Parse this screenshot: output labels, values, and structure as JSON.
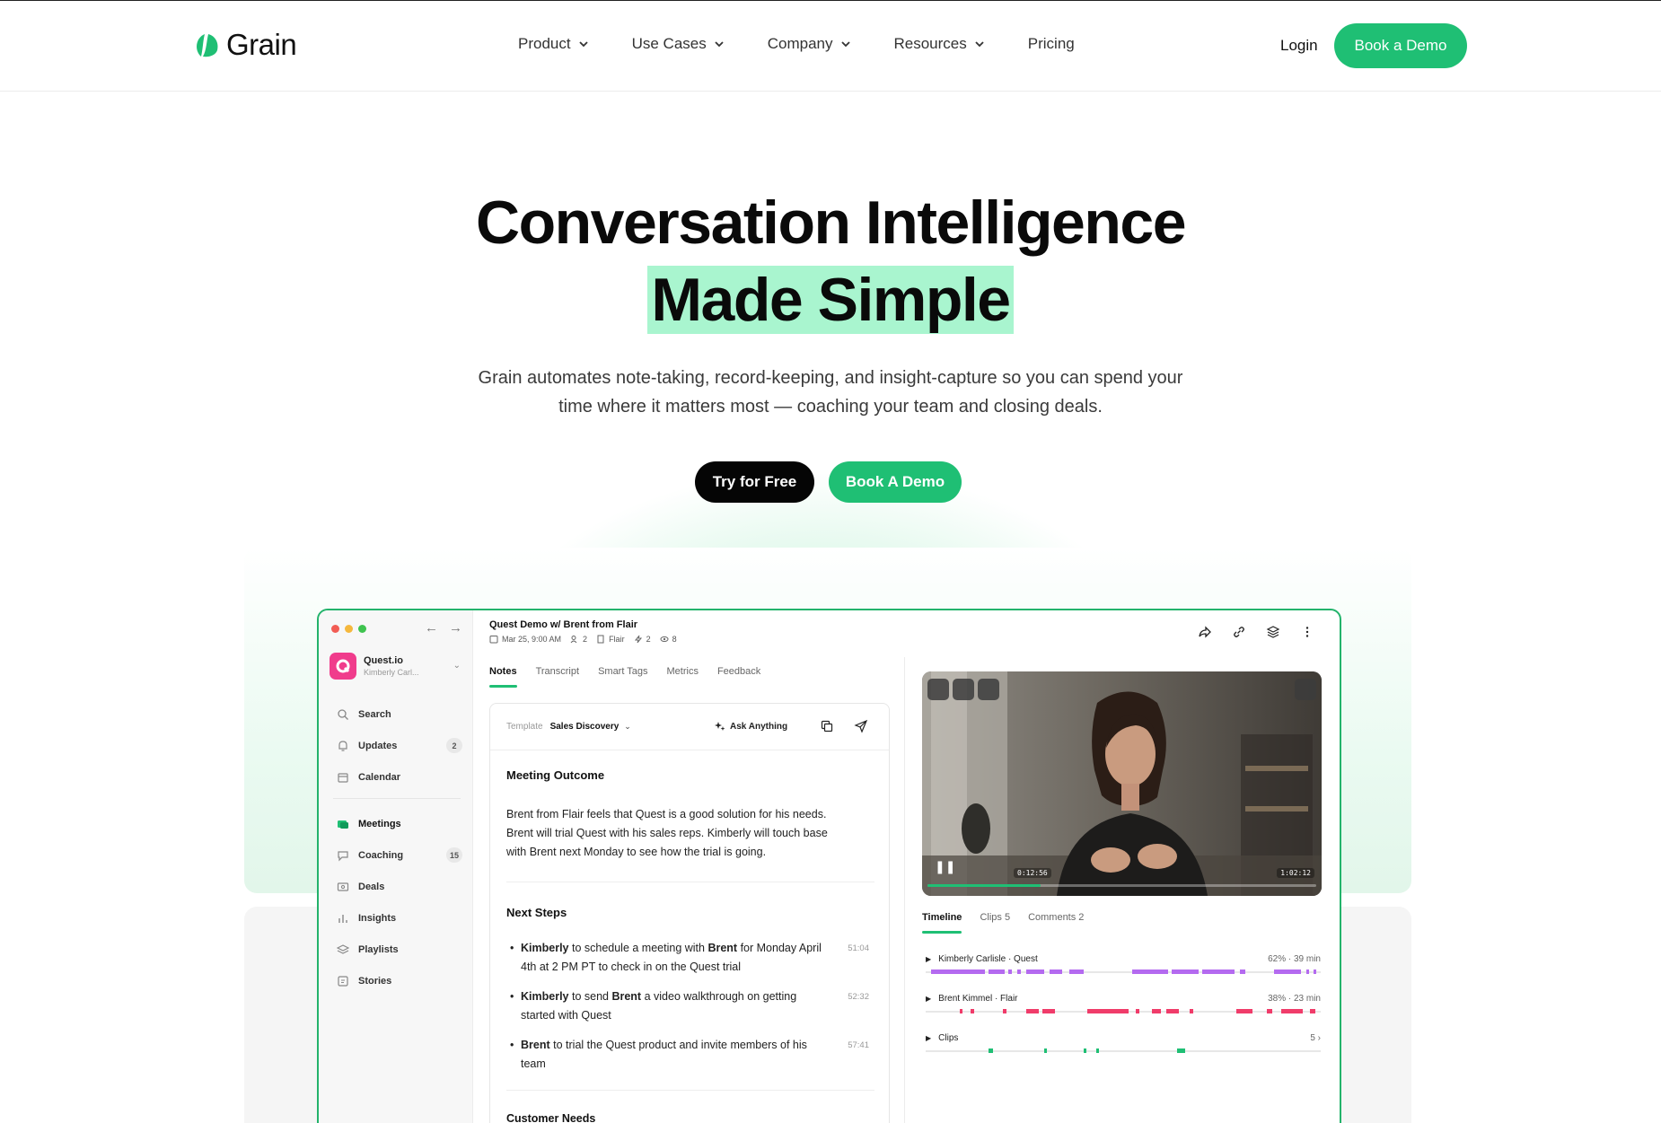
{
  "nav": {
    "brand": "Grain",
    "menu": [
      {
        "label": "Product",
        "dropdown": true
      },
      {
        "label": "Use Cases",
        "dropdown": true
      },
      {
        "label": "Company",
        "dropdown": true
      },
      {
        "label": "Resources",
        "dropdown": true
      },
      {
        "label": "Pricing",
        "dropdown": false
      }
    ],
    "login": "Login",
    "book_demo": "Book a Demo"
  },
  "hero": {
    "title_line1": "Conversation Intelligence",
    "title_line2": "Made Simple",
    "subtitle_line1": "Grain automates note-taking, record-keeping, and insight-capture so you can spend your",
    "subtitle_line2": "time where it matters most — coaching your team and closing deals.",
    "cta_primary": "Try for Free",
    "cta_secondary": "Book A Demo"
  },
  "colors": {
    "brand_green": "#1fbf74",
    "highlight": "#a9f5cf",
    "pink": "#f03c8c",
    "purple": "#b46af0"
  },
  "app": {
    "workspace": {
      "name": "Quest.io",
      "user": "Kimberly Carl..."
    },
    "sidebar": [
      {
        "label": "Search",
        "icon": "search-icon",
        "badge": ""
      },
      {
        "label": "Updates",
        "icon": "bell-icon",
        "badge": "2"
      },
      {
        "label": "Calendar",
        "icon": "calendar-icon",
        "badge": ""
      },
      {
        "label": "Meetings",
        "icon": "meetings-icon",
        "badge": ""
      },
      {
        "label": "Coaching",
        "icon": "coaching-icon",
        "badge": "15"
      },
      {
        "label": "Deals",
        "icon": "deals-icon",
        "badge": ""
      },
      {
        "label": "Insights",
        "icon": "insights-icon",
        "badge": ""
      },
      {
        "label": "Playlists",
        "icon": "playlists-icon",
        "badge": ""
      },
      {
        "label": "Stories",
        "icon": "stories-icon",
        "badge": ""
      }
    ],
    "meeting": {
      "title": "Quest Demo w/ Brent from Flair",
      "date": "Mar 25, 9:00 AM",
      "participants": "2",
      "company": "Flair",
      "clips": "2",
      "views": "8"
    },
    "tabs": [
      "Notes",
      "Transcript",
      "Smart Tags",
      "Metrics",
      "Feedback"
    ],
    "notes": {
      "template_label": "Template",
      "template_value": "Sales Discovery",
      "ask_anything": "Ask Anything",
      "outcome_heading": "Meeting Outcome",
      "outcome_line1": "Brent from Flair feels that Quest is a good solution for his needs.",
      "outcome_line2": "Brent will trial Quest with his sales reps. Kimberly will touch base",
      "outcome_line3": "with Brent next Monday to see how the trial is going.",
      "next_steps_heading": "Next Steps",
      "steps": [
        {
          "ts": "51:04"
        },
        {
          "ts": "52:32"
        },
        {
          "ts": "57:41"
        }
      ],
      "customer_needs_heading": "Customer Needs"
    },
    "video": {
      "current_time": "0:12:56",
      "duration": "1:02:12",
      "progress": 0.29
    },
    "right_tabs": [
      "Timeline",
      "Clips 5",
      "Comments 2"
    ],
    "tracks": [
      {
        "name": "Kimberly Carlisle · Quest",
        "stat": "62% · 39 min"
      },
      {
        "name": "Brent Kimmel · Flair",
        "stat": "38% · 23 min"
      },
      {
        "name": "Clips",
        "stat": "5"
      }
    ]
  }
}
